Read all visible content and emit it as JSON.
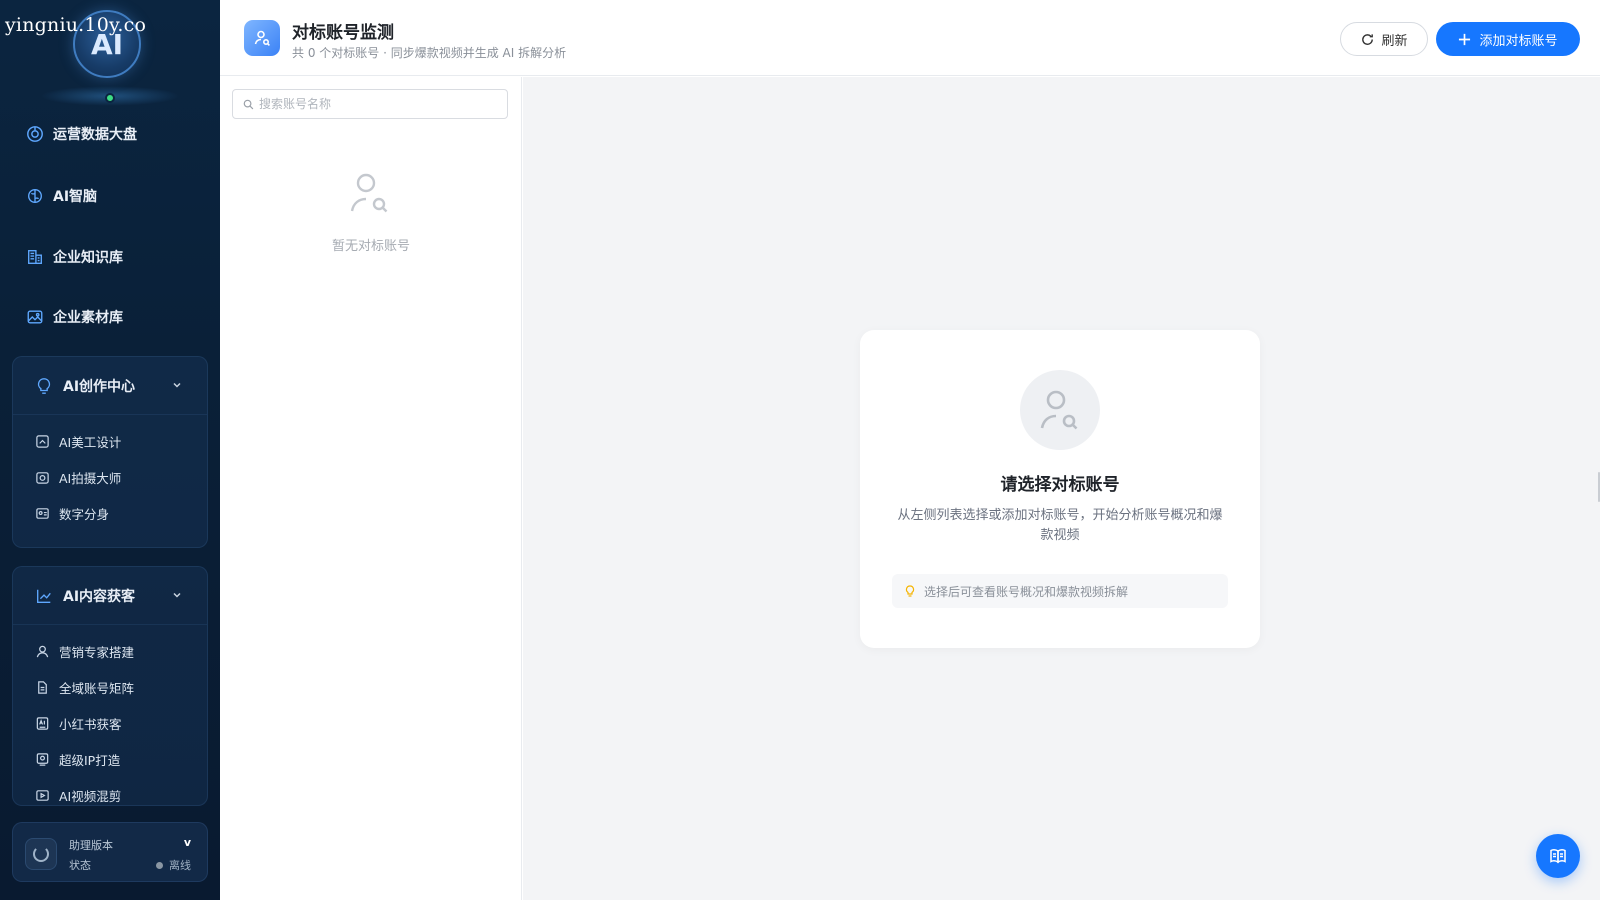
{
  "watermark": "yingniu.10y.co",
  "logo": {
    "text": "AI"
  },
  "sidebar": {
    "nav": [
      {
        "label": "运营数据大盘",
        "icon": "dashboard-icon"
      },
      {
        "label": "AI智脑",
        "icon": "brain-icon"
      },
      {
        "label": "企业知识库",
        "icon": "building-icon"
      },
      {
        "label": "企业素材库",
        "icon": "image-icon"
      }
    ],
    "groups": [
      {
        "label": "AI创作中心",
        "icon": "bulb-icon",
        "items": [
          {
            "label": "AI美工设计",
            "icon": "palette-icon"
          },
          {
            "label": "AI拍摄大师",
            "icon": "camera-icon"
          },
          {
            "label": "数字分身",
            "icon": "id-card-icon"
          }
        ]
      },
      {
        "label": "AI内容获客",
        "icon": "chart-icon",
        "items": [
          {
            "label": "营销专家搭建",
            "icon": "user-icon"
          },
          {
            "label": "全域账号矩阵",
            "icon": "file-icon"
          },
          {
            "label": "小红书获客",
            "icon": "ai-box-icon"
          },
          {
            "label": "超级IP打造",
            "icon": "badge-icon"
          },
          {
            "label": "AI视频混剪",
            "icon": "video-icon"
          }
        ]
      }
    ],
    "status": {
      "version_label": "助理版本",
      "version_value": "v",
      "state_label": "状态",
      "state_value": "离线",
      "state_color": "#8a96a3"
    }
  },
  "header": {
    "title": "对标账号监测",
    "subtitle": "共 0 个对标账号 · 同步爆款视频并生成 AI 拆解分析",
    "refresh_label": "刷新",
    "add_label": "添加对标账号"
  },
  "left_panel": {
    "search_placeholder": "搜索账号名称",
    "empty_text": "暂无对标账号"
  },
  "main_card": {
    "title": "请选择对标账号",
    "description": "从左侧列表选择或添加对标账号，开始分析账号概况和爆款视频",
    "tip": "选择后可查看账号概况和爆款视频拆解"
  },
  "colors": {
    "accent": "#1677ff",
    "sidebar_bg": "#0b2540",
    "online_dot": "#3ddc84",
    "tip_bulb": "#f5b400"
  }
}
